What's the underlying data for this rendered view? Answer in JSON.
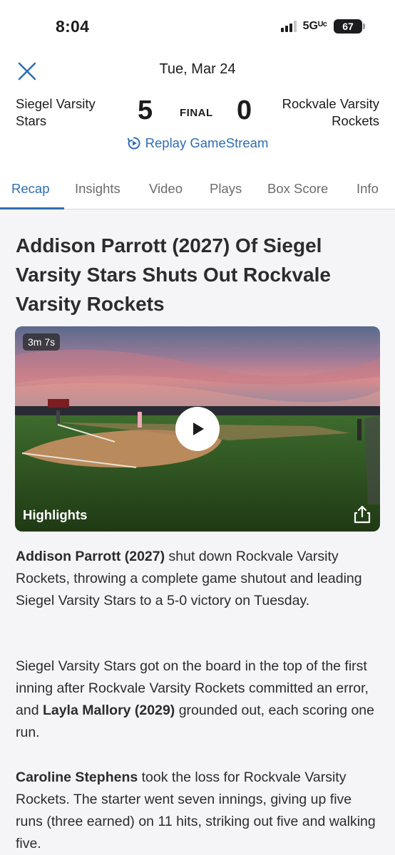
{
  "status_bar": {
    "time": "8:04",
    "network": "5Gᵁᶜ",
    "battery": "67"
  },
  "header": {
    "date": "Tue, Mar 24",
    "home_team": "Siegel Varsity Stars",
    "home_score": "5",
    "status": "FINAL",
    "away_score": "0",
    "away_team": "Rockvale Varsity Rockets",
    "replay_label": "Replay GameStream",
    "close_icon": "close-icon",
    "replay_icon": "replay-icon"
  },
  "tabs": [
    {
      "label": "Recap",
      "active": true
    },
    {
      "label": "Insights",
      "active": false
    },
    {
      "label": "Video",
      "active": false
    },
    {
      "label": "Plays",
      "active": false
    },
    {
      "label": "Box Score",
      "active": false
    },
    {
      "label": "Info",
      "active": false
    }
  ],
  "article": {
    "headline": "Addison Parrott (2027) Of Siegel Varsity Stars Shuts Out Rockvale Varsity Rockets",
    "video": {
      "duration": "3m 7s",
      "caption": "Highlights",
      "play_icon": "play-icon",
      "share_icon": "share-icon"
    },
    "p1": {
      "bold": "Addison Parrott (2027)",
      "rest": " shut down Rockvale Varsity Rockets, throwing a complete game shutout and leading Siegel Varsity Stars to a 5-0 victory on Tuesday."
    },
    "p2": {
      "pre": "Siegel Varsity Stars got on the board in the top of the first inning after Rockvale Varsity Rockets committed an error, and ",
      "bold": "Layla Mallory (2029)",
      "post": " grounded out, each scoring one run."
    },
    "p3": {
      "bold": "Caroline Stephens",
      "rest": " took the loss for Rockvale Varsity Rockets. The starter went seven innings, giving up five runs (three earned) on 11 hits, striking out five and walking five."
    }
  },
  "colors": {
    "accent": "#2f6db5",
    "text": "#1c1c1e",
    "muted": "#6c6c70",
    "background": "#f5f5f7"
  }
}
